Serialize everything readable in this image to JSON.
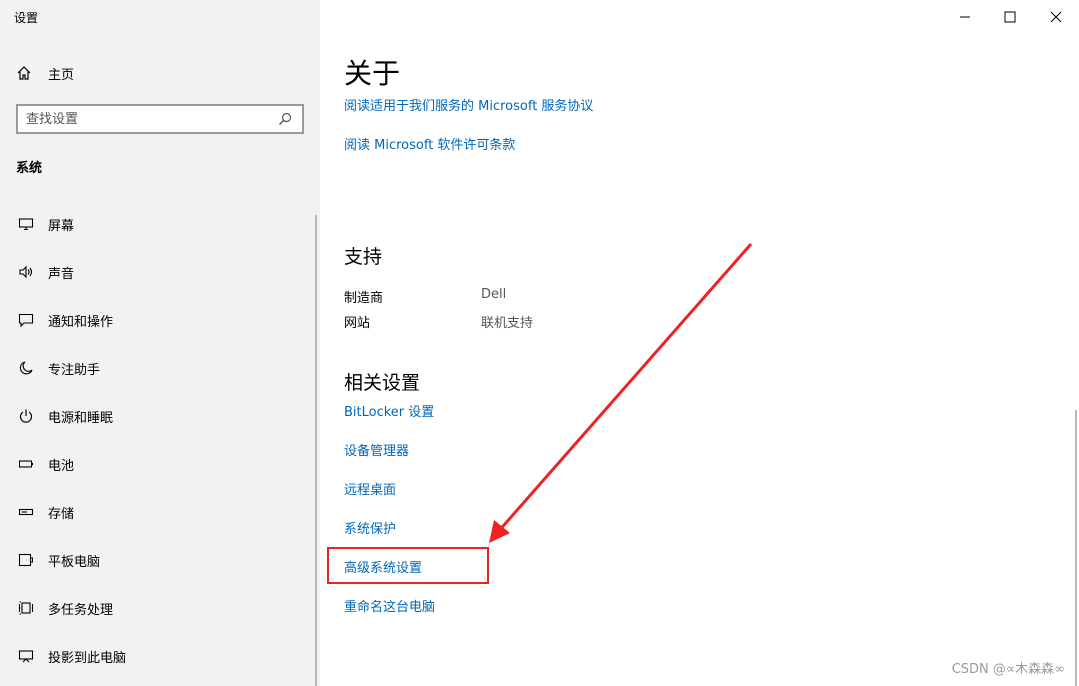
{
  "window": {
    "title": "设置"
  },
  "sidebar": {
    "home_label": "主页",
    "search_placeholder": "查找设置",
    "section_label": "系统",
    "items": [
      {
        "label": "屏幕",
        "icon": "monitor-icon"
      },
      {
        "label": "声音",
        "icon": "speaker-icon"
      },
      {
        "label": "通知和操作",
        "icon": "notification-icon"
      },
      {
        "label": "专注助手",
        "icon": "moon-icon"
      },
      {
        "label": "电源和睡眠",
        "icon": "power-icon"
      },
      {
        "label": "电池",
        "icon": "battery-icon"
      },
      {
        "label": "存储",
        "icon": "storage-icon"
      },
      {
        "label": "平板电脑",
        "icon": "tablet-icon"
      },
      {
        "label": "多任务处理",
        "icon": "multitask-icon"
      },
      {
        "label": "投影到此电脑",
        "icon": "project-icon"
      }
    ]
  },
  "main": {
    "title": "关于",
    "links_top": [
      "阅读适用于我们服务的 Microsoft 服务协议",
      "阅读 Microsoft 软件许可条款"
    ],
    "support": {
      "heading": "支持",
      "manufacturer_label": "制造商",
      "manufacturer_value": "Dell",
      "website_label": "网站",
      "website_value": "联机支持"
    },
    "related": {
      "heading": "相关设置",
      "links": [
        "BitLocker 设置",
        "设备管理器",
        "远程桌面",
        "系统保护",
        "高级系统设置",
        "重命名这台电脑"
      ]
    }
  },
  "watermark": "CSDN @∝木森森∞",
  "colors": {
    "link": "#0067b8",
    "sidebar_bg": "#f2f2f2",
    "annotation": "#ee2222"
  }
}
